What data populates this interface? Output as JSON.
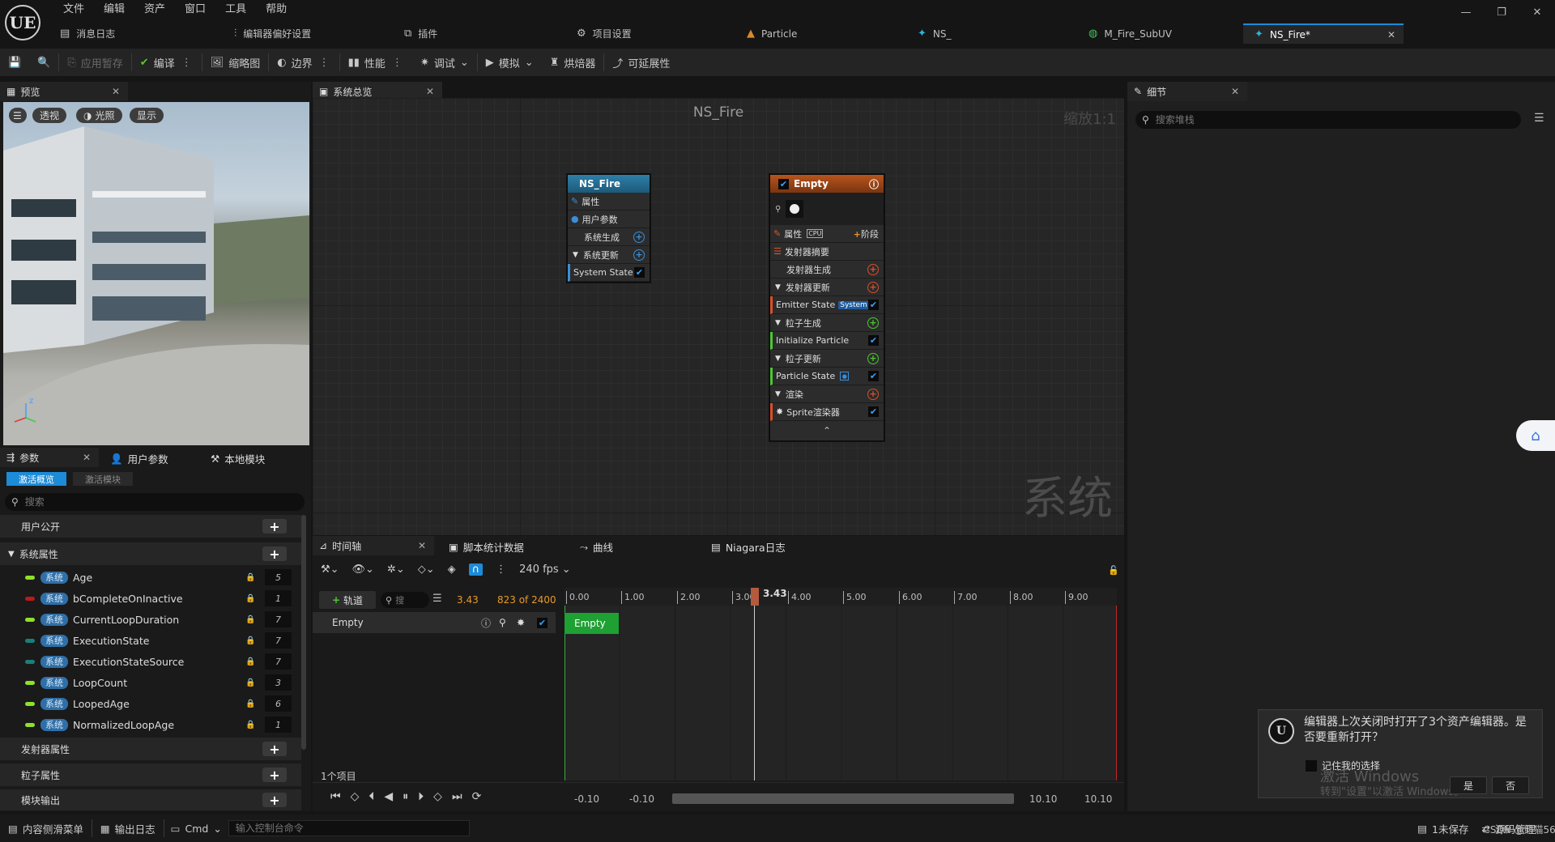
{
  "app": {
    "logo": "UE",
    "menu": [
      "文件",
      "编辑",
      "资产",
      "窗口",
      "工具",
      "帮助"
    ]
  },
  "tabs": [
    {
      "label": "消息日志",
      "icon": "message-log-icon"
    },
    {
      "label": "编辑器偏好设置",
      "icon": "sliders-icon"
    },
    {
      "label": "插件",
      "icon": "plugin-icon"
    },
    {
      "label": "项目设置",
      "icon": "settings-icon"
    },
    {
      "label": "Particle",
      "icon": "particle-icon"
    },
    {
      "label": "NS_",
      "icon": "niagara-icon"
    },
    {
      "label": "M_Fire_SubUV",
      "icon": "material-icon"
    },
    {
      "label": "NS_Fire*",
      "icon": "niagara-icon"
    }
  ],
  "toolbar": {
    "apply_label": "应用暂存",
    "compile_label": "编译",
    "thumbnail_label": "缩略图",
    "bounds_label": "边界",
    "perf_label": "性能",
    "debug_label": "调试",
    "simulate_label": "模拟",
    "baker_label": "烘焙器",
    "scalable_label": "可延展性"
  },
  "preview": {
    "tab_label": "预览",
    "perspective": "透视",
    "lit": "光照",
    "show": "显示"
  },
  "params": {
    "tabs": [
      "参数",
      "用户参数",
      "本地模块"
    ],
    "subtabs": [
      "激活概览",
      "激活模块"
    ],
    "search_placeholder": "搜索",
    "user_section": "用户公开",
    "system_section": "系统属性",
    "badge": "系统",
    "rows": [
      {
        "name": "Age",
        "value": "5",
        "color": "#8fe02a"
      },
      {
        "name": "bCompleteOnInactive",
        "value": "1",
        "color": "#b81b1b"
      },
      {
        "name": "CurrentLoopDuration",
        "value": "7",
        "color": "#8fe02a"
      },
      {
        "name": "ExecutionState",
        "value": "7",
        "color": "#1a7f7a"
      },
      {
        "name": "ExecutionStateSource",
        "value": "7",
        "color": "#1a7f7a"
      },
      {
        "name": "LoopCount",
        "value": "3",
        "color": "#8fe02a"
      },
      {
        "name": "LoopedAge",
        "value": "6",
        "color": "#8fe02a"
      },
      {
        "name": "NormalizedLoopAge",
        "value": "1",
        "color": "#8fe02a"
      }
    ],
    "emitter_section": "发射器属性",
    "particle_section": "粒子属性",
    "module_output": "模块输出"
  },
  "graph": {
    "tab_label": "系统总览",
    "title": "NS_Fire",
    "zoom": "缩放1:1",
    "watermark": "系统",
    "system_node": {
      "title": "NS_Fire",
      "rows": [
        "属性",
        "用户参数",
        "系统生成",
        "系统更新",
        "System State"
      ]
    },
    "emitter_node": {
      "title": "Empty",
      "props": "属性",
      "cpu": "CPU",
      "stage": "阶段",
      "summary": "发射器摘要",
      "emitter_spawn": "发射器生成",
      "emitter_update": "发射器更新",
      "emitter_state": "Emitter State",
      "emitter_state_badge": "System",
      "particle_spawn": "粒子生成",
      "init_particle": "Initialize Particle",
      "particle_update": "粒子更新",
      "particle_state": "Particle State",
      "render": "渲染",
      "sprite": "Sprite渲染器"
    }
  },
  "timeline": {
    "tabs": [
      "时间轴",
      "脚本统计数据",
      "曲线",
      "Niagara日志"
    ],
    "fps": "240 fps",
    "track_btn": "轨道",
    "search_placeholder": "搜",
    "current_time": "3.43",
    "frame": "823 of 2400",
    "playhead": "3.43",
    "ticks": [
      "0.00",
      "1.00",
      "2.00",
      "3.00",
      "4.00",
      "5.00",
      "6.00",
      "7.00",
      "8.00",
      "9.00"
    ],
    "track_name": "Empty",
    "bar_label": "Empty",
    "item_count": "1个项目",
    "range_left1": "-0.10",
    "range_left2": "-0.10",
    "range_right1": "10.10",
    "range_right2": "10.10"
  },
  "details": {
    "tab_label": "细节",
    "search_placeholder": "搜索堆栈"
  },
  "bottom": {
    "content_drawer": "内容侧滑菜单",
    "output_log": "输出日志",
    "cmd": "Cmd",
    "console_placeholder": "输入控制台命令",
    "unsaved": "1未保存",
    "source_control": "源码管理"
  },
  "notification": {
    "message": "编辑器上次关闭时打开了3个资产编辑器。是否要重新打开？",
    "remember": "记住我的选择",
    "yes": "是",
    "no": "否",
    "watermark1": "激活 Windows",
    "watermark2": "转到\"设置\"以激活 Windows。",
    "csdn": "CSDN @熊猫56"
  }
}
